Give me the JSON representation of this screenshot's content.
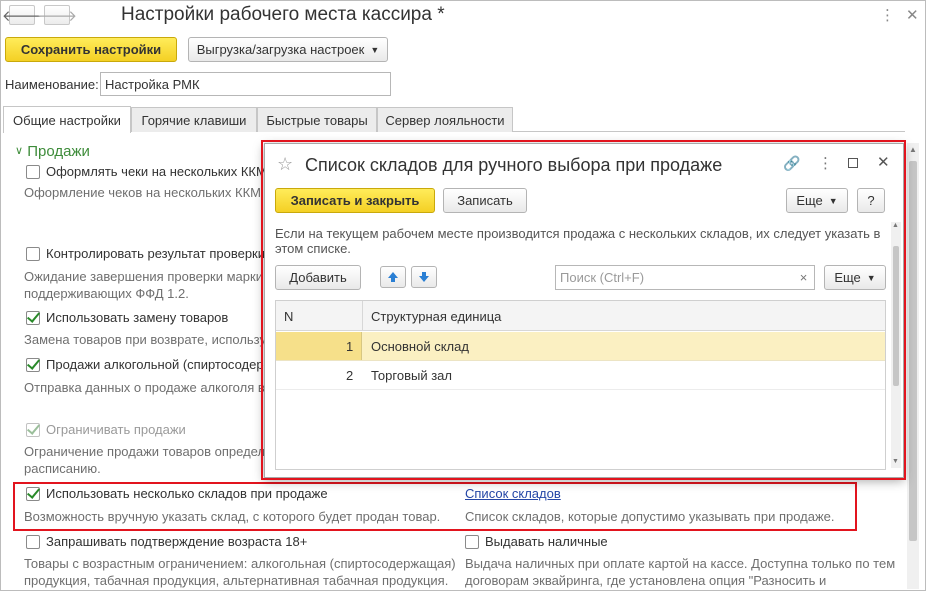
{
  "window": {
    "title": "Настройки рабочего места кассира *"
  },
  "toolbar": {
    "save_label": "Сохранить настройки",
    "export_label": "Выгрузка/загрузка настроек"
  },
  "name_field": {
    "label": "Наименование:",
    "value": "Настройка РМК"
  },
  "tabs": [
    {
      "label": "Общие настройки",
      "active": true
    },
    {
      "label": "Горячие клавиши",
      "active": false
    },
    {
      "label": "Быстрые товары",
      "active": false
    },
    {
      "label": "Сервер лояльности",
      "active": false
    }
  ],
  "section": {
    "title": "Продажи",
    "options": [
      {
        "label": "Оформлять чеки на нескольких ККМ",
        "checked": false,
        "enabled": true,
        "description": "Оформление чеков на нескольких ККМ"
      },
      {
        "label": "Контролировать результат проверки",
        "checked": false,
        "enabled": true,
        "description_lines": [
          "Ожидание завершения проверки марки",
          "поддерживающих ФФД 1.2."
        ]
      },
      {
        "label": "Использовать замену товаров",
        "checked": true,
        "enabled": true,
        "description": "Замена товаров при возврате, использу"
      },
      {
        "label": "Продажи алкогольной (спиртосодер",
        "checked": true,
        "enabled": true,
        "description": "Отправка данных о продаже алкоголя в"
      },
      {
        "label": "Ограничивать продажи",
        "checked": true,
        "enabled": false,
        "description_lines": [
          "Ограничение продажи товаров определ",
          "расписанию."
        ]
      },
      {
        "label": "Использовать несколько складов при продаже",
        "checked": true,
        "enabled": true,
        "description": "Возможность вручную указать склад, с которого будет продан товар.",
        "link": "Список складов",
        "link_description": "Список складов, которые допустимо указывать при продаже."
      },
      {
        "label": "Запрашивать подтверждение возраста 18+",
        "checked": false,
        "enabled": true,
        "description_lines": [
          "Товары с возрастным ограничением: алкогольная (спиртосодержащая)",
          "продукция, табачная продукция, альтернативная табачная продукция."
        ]
      },
      {
        "label": "Выдавать наличные",
        "checked": false,
        "enabled": true,
        "description_lines": [
          "Выдача наличных при оплате картой на кассе. Доступна только по тем",
          "договорам эквайринга, где установлена опция \"Разносить и"
        ]
      }
    ]
  },
  "modal": {
    "title": "Список складов для ручного выбора при продаже",
    "save_close_label": "Записать и закрыть",
    "save_label": "Записать",
    "more_label": "Еще",
    "help_label": "?",
    "info_lines": [
      "Если на текущем рабочем месте производится продажа с нескольких складов, их следует указать в",
      "этом списке."
    ],
    "add_label": "Добавить",
    "search_placeholder": "Поиск (Ctrl+F)",
    "clear_label": "×",
    "more2_label": "Еще",
    "columns": [
      "N",
      "Структурная единица"
    ],
    "rows": [
      {
        "n": "1",
        "unit": "Основной склад",
        "selected": true
      },
      {
        "n": "2",
        "unit": "Торговый зал",
        "selected": false
      }
    ]
  },
  "colors": {
    "accent_yellow": "#f4d024",
    "highlight_red": "#e2141e",
    "group_green": "#3e8c3a",
    "selected_row": "#fbf0c2",
    "link_blue": "#2446a6"
  },
  "icons": [
    "back-arrow-icon",
    "forward-arrow-icon",
    "more-vert-icon",
    "close-icon",
    "star-icon",
    "link-icon",
    "maximize-icon",
    "arrow-up-icon",
    "arrow-down-icon",
    "dropdown-icon",
    "expand-icon"
  ]
}
